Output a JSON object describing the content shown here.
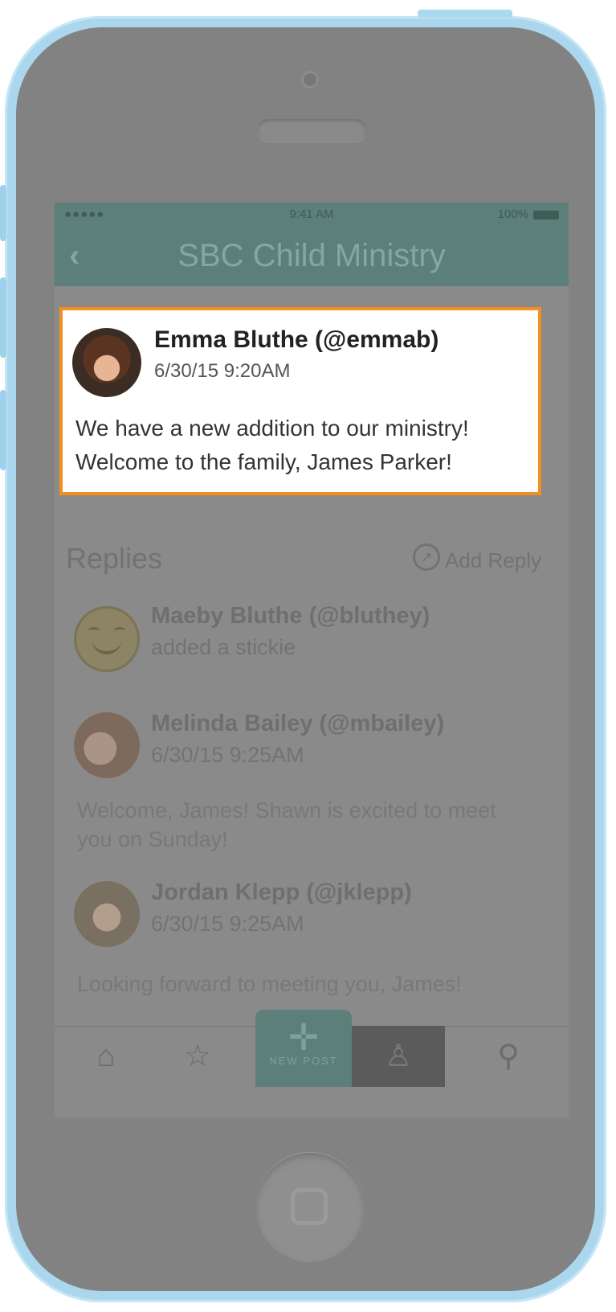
{
  "statusbar": {
    "signal": "●●●●● ",
    "time": "9:41 AM",
    "battery": "100%"
  },
  "navbar": {
    "back_icon": "chevron-left-icon",
    "back_glyph": "‹",
    "title": "SBC Child Ministry"
  },
  "post": {
    "author": "Emma Bluthe (@emmab)",
    "timestamp": "6/30/15  9:20AM",
    "body": "We have a new addition to our ministry! Welcome to the family, James Parker!"
  },
  "replies": {
    "heading": "Replies",
    "add_reply_label": "Add Reply",
    "add_reply_icon": "reply-arrow-icon",
    "items": [
      {
        "name": "Maeby Bluthe (@bluthey)",
        "sub": "added a stickie",
        "text": ""
      },
      {
        "name": "Melinda Bailey (@mbailey)",
        "sub": "6/30/15  9:25AM",
        "text": "Welcome, James!  Shawn is excited to meet you on Sunday!"
      },
      {
        "name": "Jordan Klepp (@jklepp)",
        "sub": "6/30/15  9:25AM",
        "text": "Looking forward to meeting you, James!"
      }
    ]
  },
  "tabbar": {
    "home_glyph": "⌂",
    "favorites_glyph": "☆",
    "new_post_glyph": "✛",
    "new_post_label": "NEW POST",
    "profile_glyph": "♙",
    "search_glyph": "⚲"
  },
  "colors": {
    "highlight": "#f28f1e",
    "brand": "#b3e2d8",
    "phone_shell": "#aad7ee"
  }
}
